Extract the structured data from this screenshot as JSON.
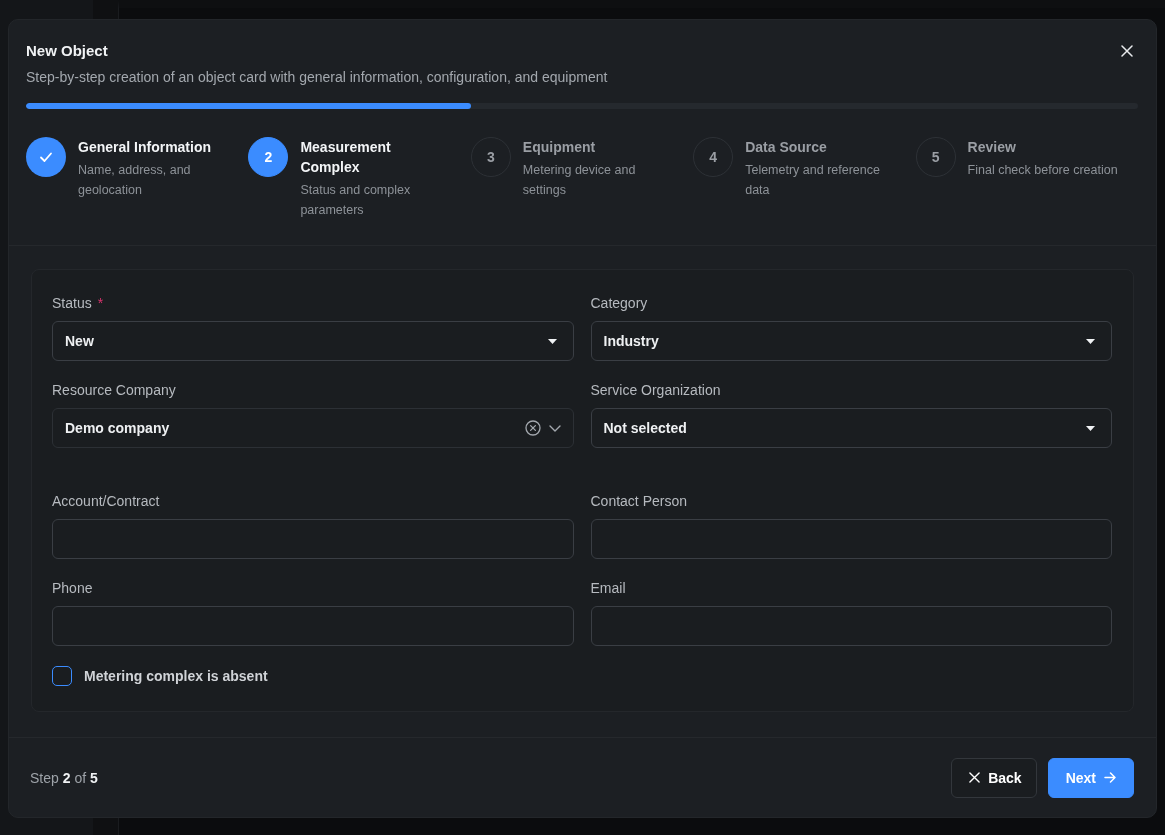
{
  "dialog": {
    "title": "New Object",
    "subtitle": "Step-by-step creation of an object card with general information, configuration, and equipment"
  },
  "progress": {
    "level": 0.4
  },
  "steps": [
    {
      "done": true,
      "current": false,
      "title": "General Information",
      "description": "Name, address, and geolocation"
    },
    {
      "done": false,
      "current": true,
      "number": "2",
      "title": "Measurement Complex",
      "description": "Status and complex parameters"
    },
    {
      "done": false,
      "current": false,
      "number": "3",
      "title": "Equipment",
      "description": "Metering device and settings"
    },
    {
      "done": false,
      "current": false,
      "number": "4",
      "title": "Data Source",
      "description": "Telemetry and reference data"
    },
    {
      "done": false,
      "current": false,
      "number": "5",
      "title": "Review",
      "description": "Final check before creation"
    }
  ],
  "form": {
    "sections": [
      {
        "fields": [
          {
            "kind": "select",
            "label": "Status",
            "required_mark": "*",
            "value": "New"
          },
          {
            "kind": "select",
            "label": "Category",
            "value": "Industry"
          },
          {
            "kind": "combobox",
            "label": "Resource Company",
            "value": "Demo company"
          },
          {
            "kind": "select",
            "label": "Service Organization",
            "value": "Not selected"
          }
        ]
      },
      {
        "fields": [
          {
            "kind": "text",
            "label": "Account/Contract"
          },
          {
            "kind": "text",
            "label": "Contact Person"
          },
          {
            "kind": "text",
            "label": "Phone"
          },
          {
            "kind": "text",
            "label": "Email"
          }
        ]
      }
    ],
    "checkbox": {
      "label": "Metering complex is absent",
      "checked": false
    }
  },
  "footer": {
    "step_text": "Step **2** of **5**",
    "buttons": [
      {
        "kind": "secondary",
        "label": "Back"
      },
      {
        "kind": "primary",
        "label": "Next"
      }
    ]
  }
}
